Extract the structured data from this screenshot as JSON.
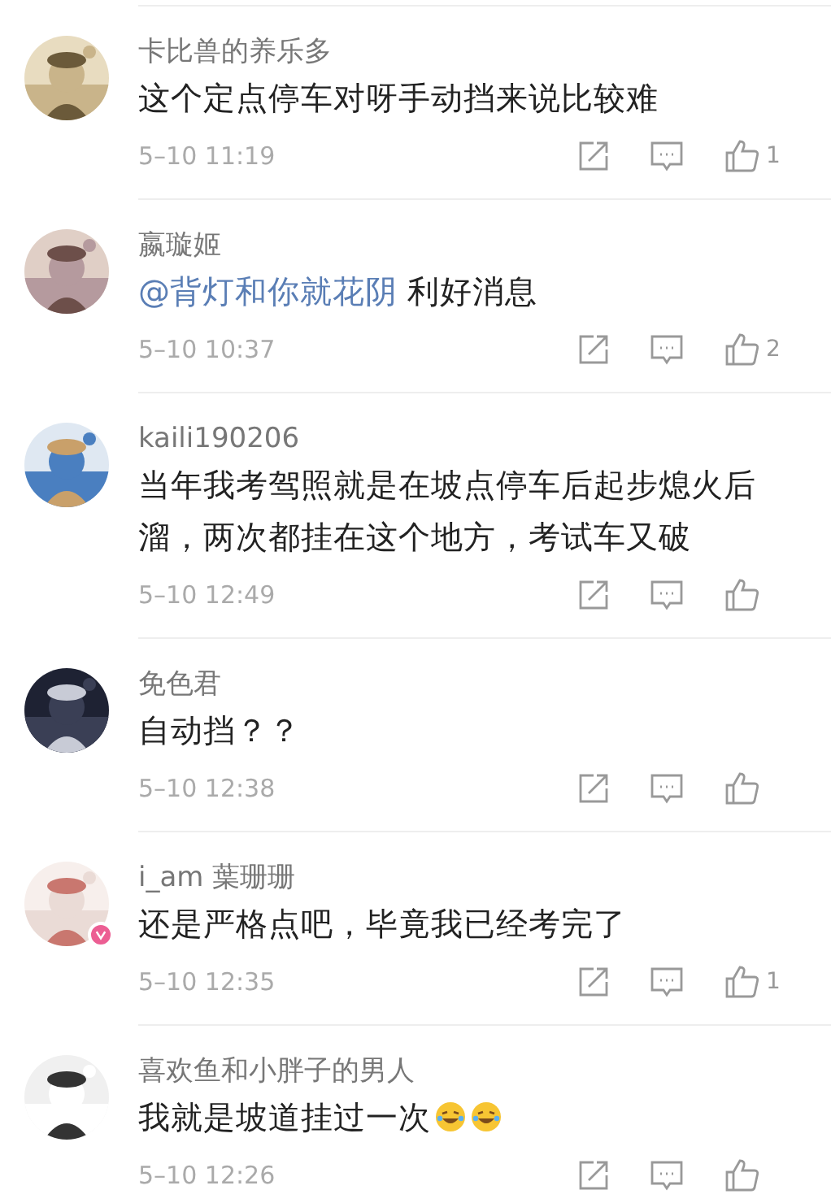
{
  "comments": [
    {
      "user": "卡比兽的养乐多",
      "verified": false,
      "text": "这个定点停车对呀手动挡来说比较难",
      "time": "5–10 11:19",
      "likes": "1"
    },
    {
      "user": "嬴璇姬",
      "verified": false,
      "mention": "@背灯和你就花阴",
      "text": "利好消息",
      "time": "5–10 10:37",
      "likes": "2"
    },
    {
      "user": "kaili190206",
      "verified": false,
      "text": "当年我考驾照就是在坡点停车后起步熄火后溜，两次都挂在这个地方，考试车又破",
      "time": "5–10 12:49"
    },
    {
      "user": "免色君",
      "verified": false,
      "text": "自动挡？？",
      "time": "5–10 12:38"
    },
    {
      "user": "i_am 葉珊珊",
      "verified": true,
      "text": "还是严格点吧，毕竟我已经考完了",
      "time": "5–10 12:35",
      "likes": "1"
    },
    {
      "user": "喜欢鱼和小胖子的男人",
      "verified": false,
      "text": "我就是坡道挂过一次",
      "emojis": [
        {
          "kind": "laugh"
        },
        {
          "kind": "laugh"
        }
      ],
      "time": "5–10 12:26"
    }
  ]
}
